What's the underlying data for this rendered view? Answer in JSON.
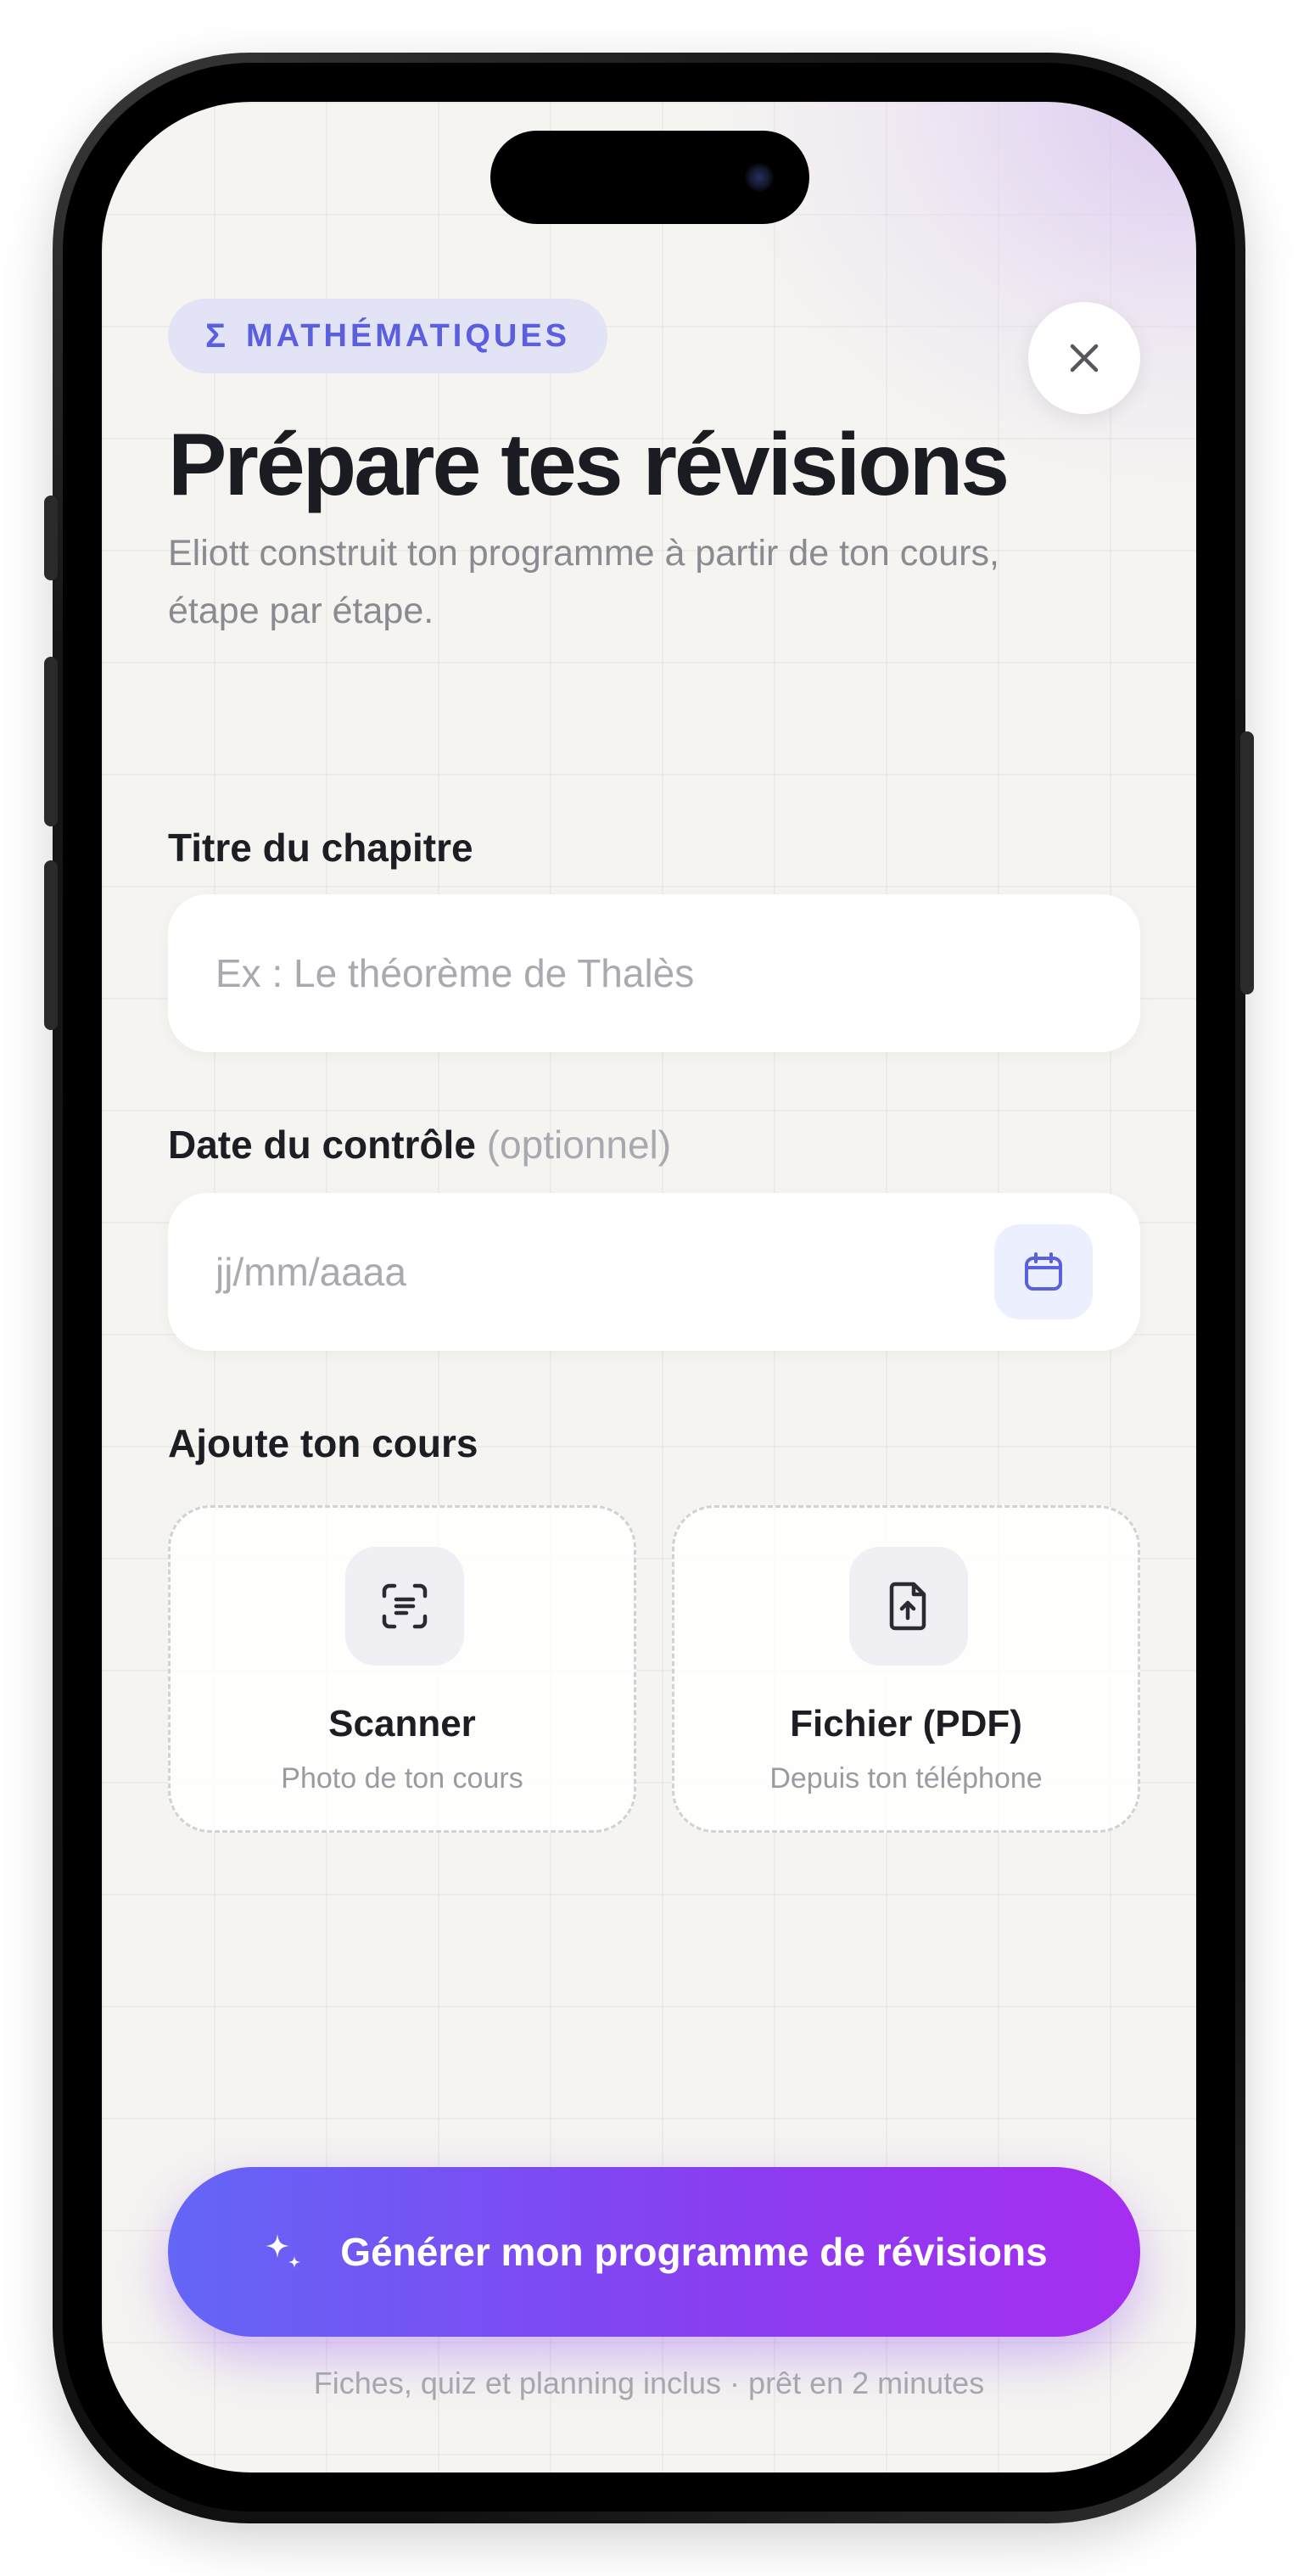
{
  "subject_badge": {
    "symbol": "Σ",
    "label": "MATHÉMATIQUES"
  },
  "header": {
    "title": "Prépare tes révisions",
    "subtitle": "Eliott construit ton programme à partir de ton cours, étape par étape."
  },
  "chapter": {
    "label": "Titre du chapitre",
    "placeholder": "Ex : Le théorème de Thalès",
    "value": ""
  },
  "exam_date": {
    "label": "Date du contrôle",
    "optional_hint": "(optionnel)",
    "placeholder": "jj/mm/aaaa",
    "value": ""
  },
  "course_upload": {
    "label": "Ajoute ton cours",
    "options": [
      {
        "title": "Scanner",
        "subtitle": "Photo de ton cours",
        "icon": "scan-document-icon"
      },
      {
        "title": "Fichier (PDF)",
        "subtitle": "Depuis ton téléphone",
        "icon": "file-upload-icon"
      }
    ]
  },
  "cta": {
    "label": "Générer mon programme de révisions",
    "icon": "sparkles-icon"
  },
  "footer_note": "Fiches, quiz et planning inclus · prêt en 2 minutes",
  "colors": {
    "accent": "#5a5fe0",
    "cta_start": "#6366f6",
    "cta_end": "#a62ef0",
    "background": "#f5f4f1",
    "text_primary": "#1b1b22",
    "text_secondary": "#8a8a90"
  }
}
